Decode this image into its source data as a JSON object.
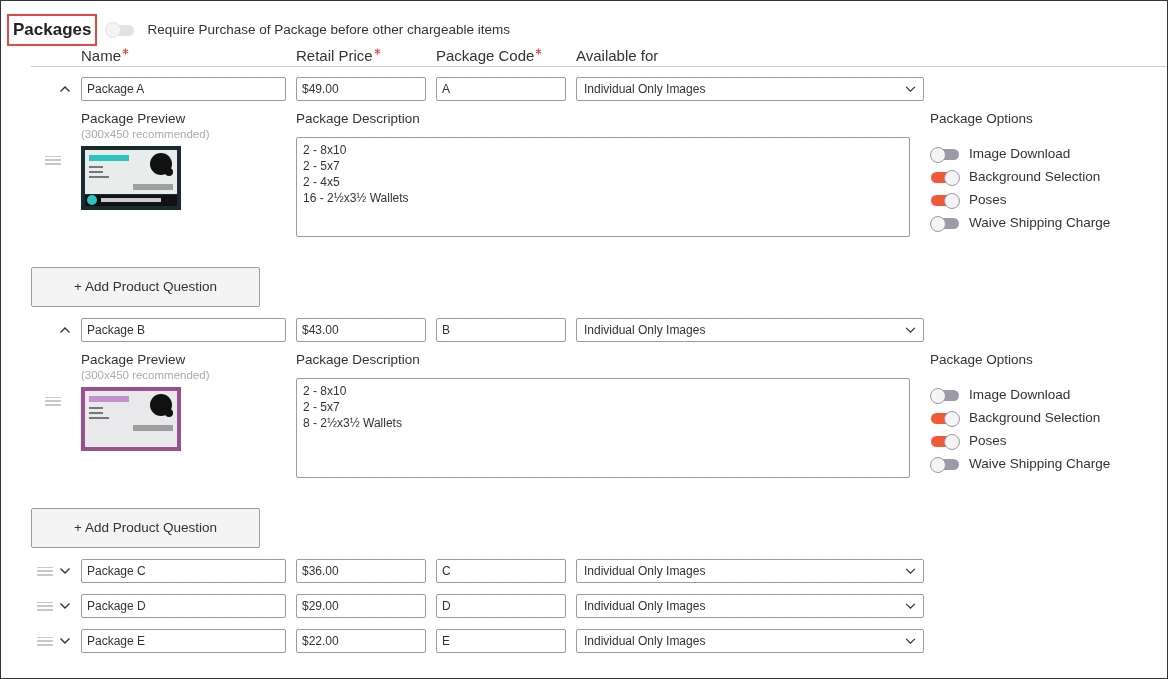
{
  "header": {
    "title": "Packages",
    "require_toggle": {
      "label": "Require Purchase of Package before other chargeable items",
      "on": false
    }
  },
  "columns": [
    {
      "label": "Name",
      "required": true
    },
    {
      "label": "Retail Price",
      "required": true
    },
    {
      "label": "Package Code",
      "required": true
    },
    {
      "label": "Available for",
      "required": false
    }
  ],
  "packages": [
    {
      "name": "Package A",
      "price": "$49.00",
      "code": "A",
      "available_for": "Individual Only Images",
      "expanded": true,
      "preview_label": "Package Preview",
      "preview_hint": "(300x450 recommended)",
      "preview": {
        "kind": "picture"
      },
      "description_label": "Package Description",
      "description": "2 - 8x10\n2 - 5x7\n2 - 4x5\n16 - 2½x3½ Wallets",
      "options_title": "Package Options",
      "options": [
        {
          "label": "Image Download",
          "on": false
        },
        {
          "label": "Background Selection",
          "on": true
        },
        {
          "label": "Poses",
          "on": true
        },
        {
          "label": "Waive Shipping Charge",
          "on": false
        }
      ],
      "add_question_button": "+ Add Product Question"
    },
    {
      "name": "Package B",
      "price": "$43.00",
      "code": "B",
      "available_for": "Individual Only Images",
      "expanded": true,
      "preview_label": "Package Preview",
      "preview_hint": "(300x450 recommended)",
      "preview": {
        "kind": "picture"
      },
      "description_label": "Package Description",
      "description": "2 - 8x10\n2 - 5x7\n8 - 2½x3½ Wallets",
      "options_title": "Package Options",
      "options": [
        {
          "label": "Image Download",
          "on": false
        },
        {
          "label": "Background Selection",
          "on": true
        },
        {
          "label": "Poses",
          "on": true
        },
        {
          "label": "Waive Shipping Charge",
          "on": false
        }
      ],
      "add_question_button": "+ Add Product Question"
    },
    {
      "name": "Package C",
      "price": "$36.00",
      "code": "C",
      "available_for": "Individual Only Images",
      "expanded": false
    },
    {
      "name": "Package D",
      "price": "$29.00",
      "code": "D",
      "available_for": "Individual Only Images",
      "expanded": false
    },
    {
      "name": "Package E",
      "price": "$22.00",
      "code": "E",
      "available_for": "Individual Only Images",
      "expanded": false
    }
  ]
}
